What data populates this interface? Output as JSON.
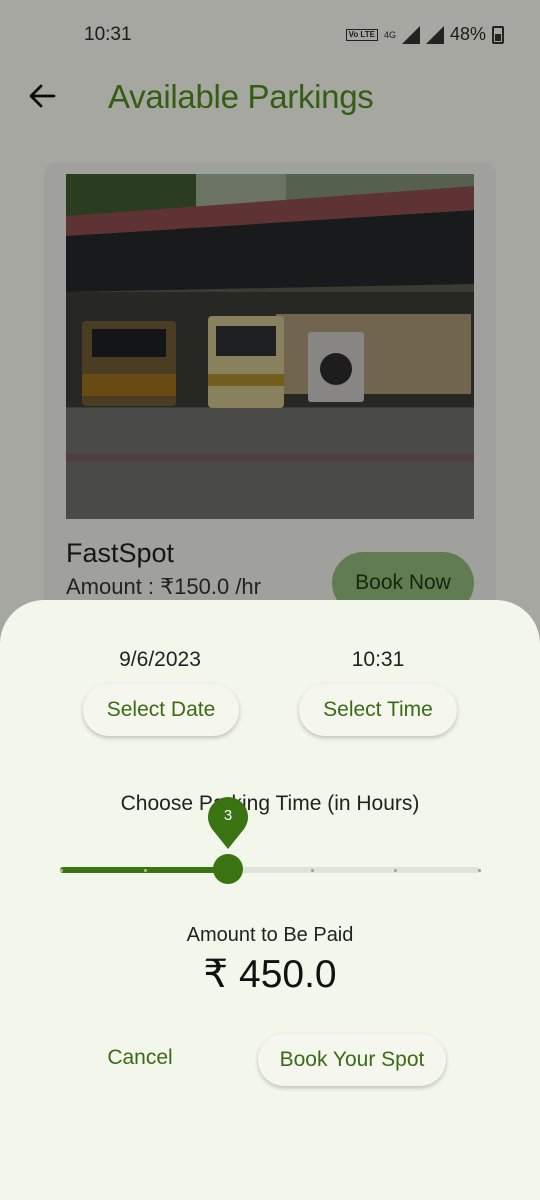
{
  "status_bar": {
    "time": "10:31",
    "volte": "Vo LTE",
    "network": "4G",
    "battery": "48%"
  },
  "app_bar": {
    "title": "Available Parkings"
  },
  "parking": {
    "name": "FastSpot",
    "amount": "Amount  :  ₹150.0 /hr",
    "book_now": "Book Now"
  },
  "sheet": {
    "date": "9/6/2023",
    "time": "10:31",
    "select_date": "Select Date",
    "select_time": "Select Time",
    "choose_label": "Choose Parking Time (in Hours)",
    "slider": {
      "value": 3,
      "min": 1,
      "max": 6,
      "value_label": "3"
    },
    "amount_label": "Amount to Be Paid",
    "amount_value": "₹ 450.0",
    "cancel": "Cancel",
    "book_spot": "Book Your Spot"
  },
  "colors": {
    "accent": "#3a7311",
    "title_green": "#4f8a1e",
    "sheet_bg": "#f3f6ea"
  }
}
